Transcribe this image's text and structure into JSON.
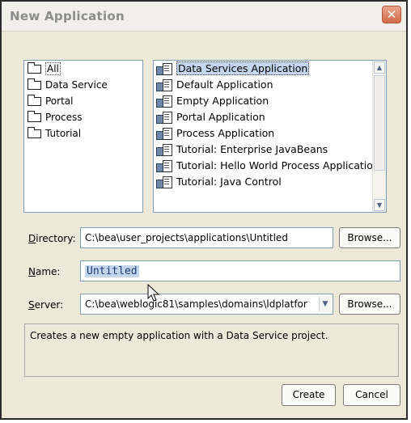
{
  "window": {
    "title": "New Application",
    "close_symbol": "✕"
  },
  "categories": [
    {
      "label": "All",
      "icon": "folder-icon",
      "selected": true
    },
    {
      "label": "Data Service",
      "icon": "folder-icon"
    },
    {
      "label": "Portal",
      "icon": "folder-icon"
    },
    {
      "label": "Process",
      "icon": "folder-icon"
    },
    {
      "label": "Tutorial",
      "icon": "folder-icon"
    }
  ],
  "applications": [
    {
      "label": "Data Services Application",
      "icon": "application-icon",
      "selected": true
    },
    {
      "label": "Default Application",
      "icon": "application-icon"
    },
    {
      "label": "Empty Application",
      "icon": "application-icon"
    },
    {
      "label": "Portal Application",
      "icon": "application-icon"
    },
    {
      "label": "Process Application",
      "icon": "application-icon"
    },
    {
      "label": "Tutorial: Enterprise JavaBeans",
      "icon": "application-icon"
    },
    {
      "label": "Tutorial: Hello World Process Application",
      "icon": "application-icon"
    },
    {
      "label": "Tutorial: Java Control",
      "icon": "application-icon"
    }
  ],
  "directory": {
    "label_mnemonic": "D",
    "label_rest": "irectory:",
    "value": "C:\\bea\\user_projects\\applications\\Untitled",
    "browse_label": "Browse..."
  },
  "name": {
    "label_mnemonic": "N",
    "label_rest": "ame:",
    "value": "Untitled"
  },
  "server": {
    "label_mnemonic": "S",
    "label_rest": "erver:",
    "value": "C:\\bea\\weblogic81\\samples\\domains\\ldplatfor",
    "browse_label": "Browse..."
  },
  "description": "Creates a new empty application with a Data Service project.",
  "buttons": {
    "create": "Create",
    "cancel": "Cancel"
  },
  "colors": {
    "dialog_bg": "#ECE9D8",
    "selection": "#C3D6EE",
    "field_border": "#7F9DB9"
  }
}
